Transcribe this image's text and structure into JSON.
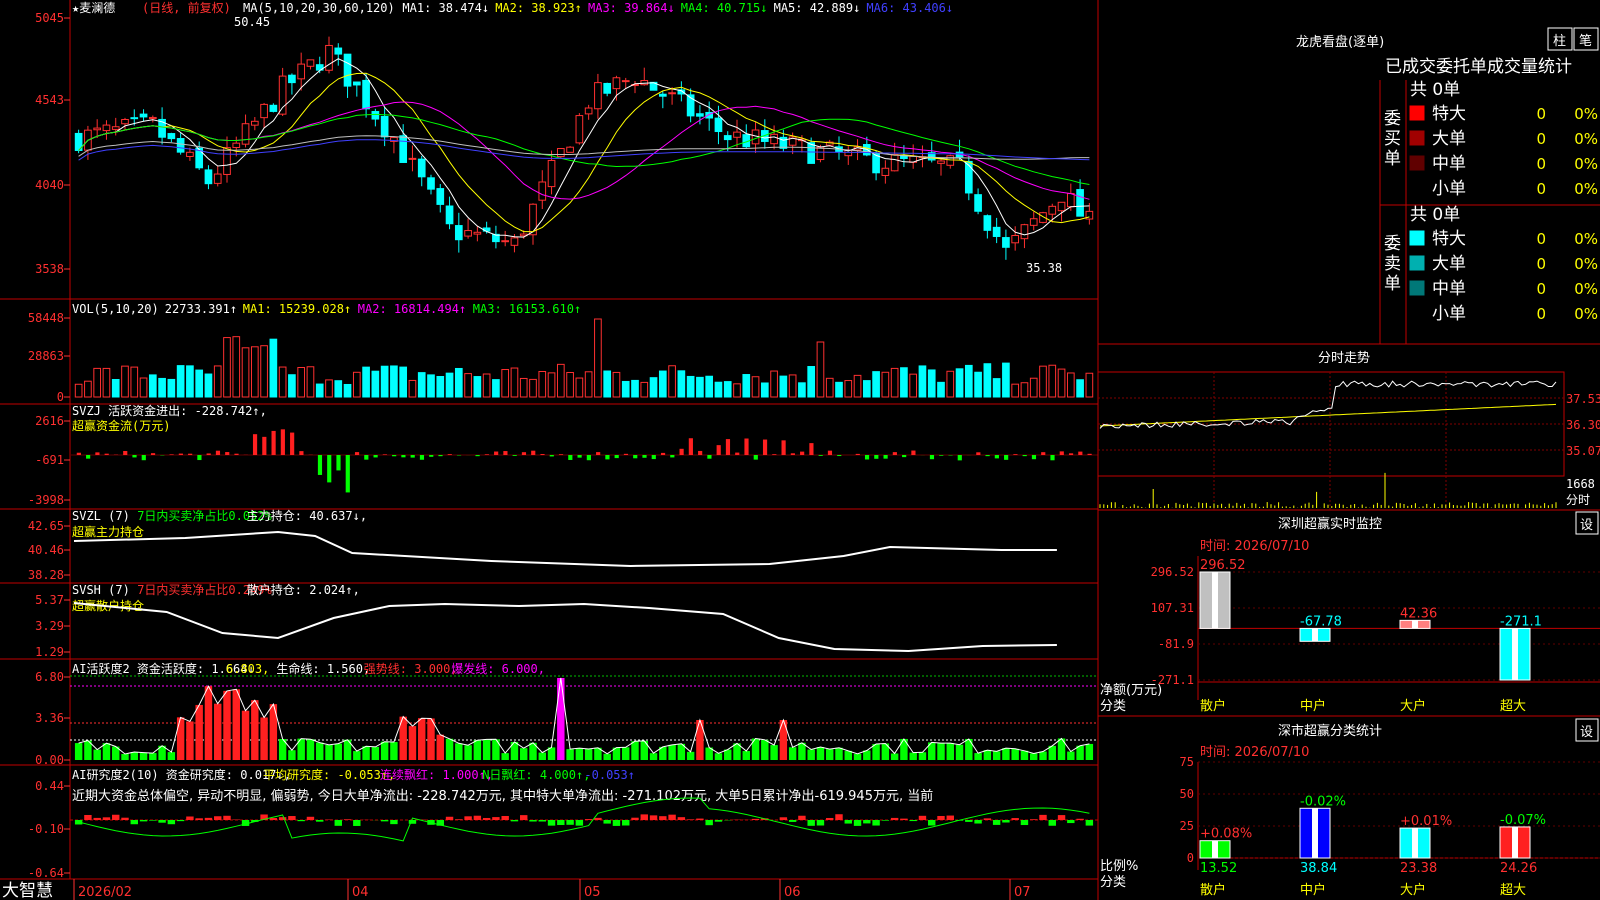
{
  "stock": {
    "name": "★麦澜德",
    "mode": "(日线, 前复权)",
    "hi_marker": "50.45",
    "lo_marker": "35.38"
  },
  "price_panel": {
    "ticks": [
      "5045",
      "4543",
      "4040",
      "3538"
    ],
    "ma_legend": [
      {
        "text": "MA(5,10,20,30,60,120)",
        "color": "#ffffff"
      },
      {
        "text": "MA1: 38.474↓",
        "color": "#ffffff"
      },
      {
        "text": "MA2: 38.923↑",
        "color": "#ffff00"
      },
      {
        "text": "MA3: 39.864↓",
        "color": "#ff00ff"
      },
      {
        "text": "MA4: 40.715↓",
        "color": "#00ff00"
      },
      {
        "text": "MA5: 42.889↓",
        "color": "#ffffff"
      },
      {
        "text": "MA6: 43.406↓",
        "color": "#4040ff"
      }
    ]
  },
  "vol_panel": {
    "ticks": [
      "58448",
      "28863",
      "0"
    ],
    "legend": [
      {
        "text": "VOL(5,10,20)",
        "color": "#ffffff"
      },
      {
        "text": "22733.391↑",
        "color": "#ffffff"
      },
      {
        "text": "MA1: 15239.028↑",
        "color": "#ffff00"
      },
      {
        "text": "MA2: 16814.494↑",
        "color": "#ff00ff"
      },
      {
        "text": "MA3: 16153.610↑",
        "color": "#00ff00"
      }
    ]
  },
  "svzj_panel": {
    "ticks": [
      "2616",
      "-691",
      "-3998"
    ],
    "title": "SVZJ  活跃资金进出: -228.742↑,",
    "subtitle": "超赢资金流(万元)"
  },
  "svzl_panel": {
    "ticks": [
      "42.65",
      "40.46",
      "38.28"
    ],
    "legend": [
      {
        "text": "SVZL (7)",
        "color": "#ffffff"
      },
      {
        "text": "7日内买卖净占比0.052%",
        "color": "#00ff00"
      },
      {
        "text": "主力持仓: 40.637↓,",
        "color": "#ffffff"
      }
    ],
    "subtitle": "超赢主力持仓"
  },
  "svsh_panel": {
    "ticks": [
      "5.37",
      "3.29",
      "1.29"
    ],
    "legend": [
      {
        "text": "SVSH (7)",
        "color": "#ffffff"
      },
      {
        "text": "7日内买卖净占比0.249%",
        "color": "#ff3030"
      },
      {
        "text": "散户持仓: 2.024↑,",
        "color": "#ffffff"
      }
    ],
    "subtitle": "超赢散户持仓"
  },
  "ai_active_panel": {
    "ticks": [
      "6.80",
      "3.36",
      "0.00"
    ],
    "legend": [
      {
        "text": "AI活跃度2 资金活跃度: 1.664↓",
        "color": "#ffffff"
      },
      {
        "text": "6.803,",
        "color": "#ffff00"
      },
      {
        "text": "生命线: 1.560,",
        "color": "#ffffff"
      },
      {
        "text": "强势线: 3.000,",
        "color": "#ff3030"
      },
      {
        "text": "爆发线: 6.000,",
        "color": "#ff00ff"
      }
    ]
  },
  "ai_research_panel": {
    "ticks": [
      "0.44",
      "-0.10",
      "-0.64"
    ],
    "legend": [
      {
        "text": "AI研究度2(10) 资金研究度: 0.017↓,",
        "color": "#ffffff"
      },
      {
        "text": "平均研究度: -0.053↑,",
        "color": "#ffff00"
      },
      {
        "text": "连续飘红: 1.000↑,",
        "color": "#ff00ff"
      },
      {
        "text": "N日飘红: 4.000↑,",
        "color": "#00ff00"
      },
      {
        "text": "-0.053↑",
        "color": "#4040ff"
      }
    ],
    "commentary": "近期大资金总体偏空, 异动不明显, 偏弱势, 今日大单净流出: -228.742万元, 其中特大单净流出: -271.102万元, 大单5日累计净出-619.945万元, 当前"
  },
  "date_axis": {
    "brand": "大智慧",
    "labels": [
      "2026/02",
      "04",
      "05",
      "06",
      "07"
    ]
  },
  "longhu": {
    "title": "龙虎看盘(逐单)",
    "tab_bar": "柱",
    "tab_pen": "笔",
    "subtitle": "已成交委托单成交量统计",
    "buy": {
      "label_chars": [
        "委",
        "买",
        "单"
      ],
      "total": "共 0单",
      "rows": [
        {
          "label": "特大",
          "count": "0",
          "pct": "0%",
          "color": "#ff0000"
        },
        {
          "label": "大单",
          "count": "0",
          "pct": "0%",
          "color": "#a00000"
        },
        {
          "label": "中单",
          "count": "0",
          "pct": "0%",
          "color": "#600000"
        },
        {
          "label": "小单",
          "count": "0",
          "pct": "0%",
          "color": "#000000"
        }
      ]
    },
    "sell": {
      "label_chars": [
        "委",
        "卖",
        "单"
      ],
      "total": "共 0单",
      "rows": [
        {
          "label": "特大",
          "count": "0",
          "pct": "0%",
          "color": "#00ffff"
        },
        {
          "label": "大单",
          "count": "0",
          "pct": "0%",
          "color": "#00b0b0"
        },
        {
          "label": "中单",
          "count": "0",
          "pct": "0%",
          "color": "#007878"
        },
        {
          "label": "小单",
          "count": "0",
          "pct": "0%",
          "color": "#000000"
        }
      ]
    }
  },
  "intraday": {
    "title": "分时走势",
    "price_ticks": [
      "37.53",
      "36.30",
      "35.07"
    ],
    "vol_tick": "1668",
    "vol_unit": "分时"
  },
  "sz_monitor": {
    "title": "深圳超赢实时监控",
    "settings": "设",
    "date": "时间: 2026/07/10",
    "yticks": [
      "296.52",
      "107.31",
      "-81.9",
      "-271.1"
    ],
    "ylabel": "净额(万元)",
    "xlabel": "分类",
    "categories": [
      "散户",
      "中户",
      "大户",
      "超大"
    ],
    "values": [
      296.52,
      -67.78,
      42.36,
      -271.1
    ],
    "value_labels": [
      "296.52",
      "-67.78",
      "42.36",
      "-271.1"
    ]
  },
  "sz_classify": {
    "title": "深市超赢分类统计",
    "settings": "设",
    "date": "时间: 2026/07/10",
    "yticks": [
      "75",
      "50",
      "25",
      "0"
    ],
    "ylabel": "比例%",
    "xlabel": "分类",
    "categories": [
      "散户",
      "中户",
      "大户",
      "超大"
    ],
    "values": [
      13.52,
      38.84,
      23.38,
      24.26
    ],
    "changes": [
      "+0.08%",
      "-0.02%",
      "+0.01%",
      "-0.07%"
    ],
    "value_labels": [
      "13.52",
      "38.84",
      "23.38",
      "24.26"
    ],
    "colors": [
      "#00ff00",
      "#0000ff",
      "#00ffff",
      "#ff2020"
    ]
  },
  "chart_data": [
    {
      "type": "candlestick",
      "title": "麦澜德 (日线, 前复权)",
      "ylim": [
        35.38,
        50.45
      ],
      "x": [
        "2026/02",
        "04",
        "05",
        "06",
        "07"
      ],
      "ma_values": {
        "MA1": 38.474,
        "MA2": 38.923,
        "MA3": 39.864,
        "MA4": 40.715,
        "MA5": 42.889,
        "MA6": 43.406
      },
      "last_volume": 22733.391
    },
    {
      "type": "bar",
      "title": "深圳超赢实时监控",
      "categories": [
        "散户",
        "中户",
        "大户",
        "超大"
      ],
      "values": [
        296.52,
        -67.78,
        42.36,
        -271.1
      ],
      "ylabel": "净额(万元)",
      "ylim": [
        -271.1,
        296.52
      ]
    },
    {
      "type": "bar",
      "title": "深市超赢分类统计",
      "categories": [
        "散户",
        "中户",
        "大户",
        "超大"
      ],
      "values": [
        13.52,
        38.84,
        23.38,
        24.26
      ],
      "ylabel": "比例%",
      "ylim": [
        0,
        75
      ]
    }
  ]
}
